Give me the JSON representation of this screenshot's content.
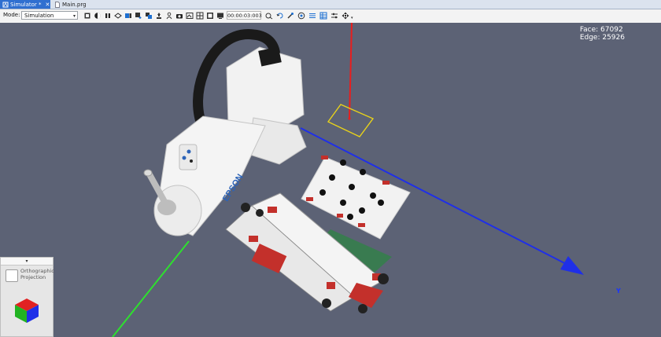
{
  "tabs": [
    {
      "label": "Simulator *",
      "active": true,
      "icon": "simulator-icon"
    },
    {
      "label": "Main.prg",
      "active": false,
      "icon": "document-icon"
    }
  ],
  "toolbar": {
    "mode_label": "Mode:",
    "mode_value": "Simulation",
    "timer": "00:00:03:003"
  },
  "viewport": {
    "face_stat": "Face: 67092",
    "edge_stat": "Edge: 25926",
    "y_axis_label": "Y",
    "robot_brand": "EPSON",
    "background_color": "#5c6275"
  },
  "projection_panel": {
    "collapse_glyph": "▾",
    "orthographic_line1": "Orthographic",
    "orthographic_line2": "Projection"
  },
  "colors": {
    "x_axis": "#1f2fe8",
    "y_axis": "#2ee02e",
    "z_axis": "#e81e1e",
    "target_outline": "#e8d21a",
    "accent": "#2f6fd0"
  }
}
